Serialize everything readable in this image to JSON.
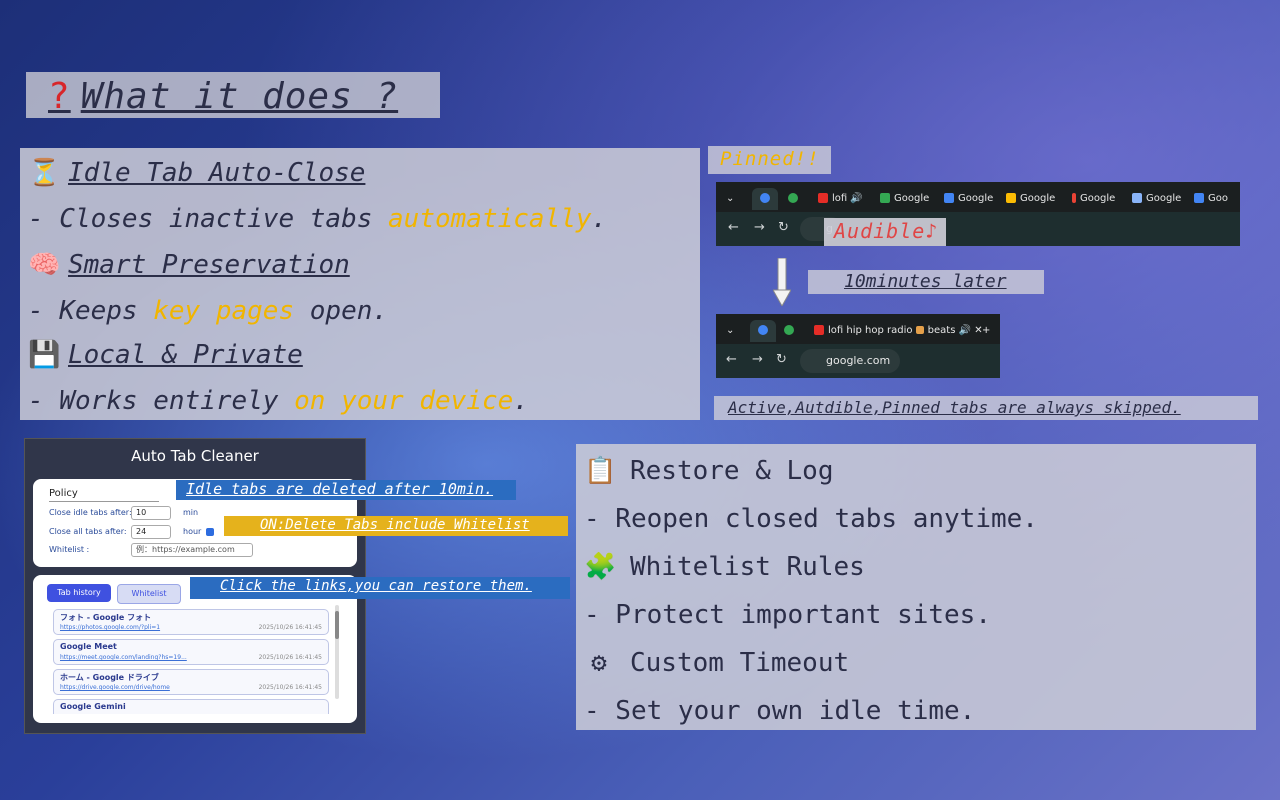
{
  "title": {
    "icon": "?",
    "text": "What it does ?"
  },
  "features": [
    {
      "icon": "⏳",
      "heading": "Idle Tab Auto-Close"
    },
    {
      "prefix": "- Closes inactive tabs ",
      "highlight": "automatically",
      "suffix": "."
    },
    {
      "icon": "🧠",
      "heading": "Smart Preservation"
    },
    {
      "prefix": "- Keeps ",
      "highlight": "key pages",
      "suffix": " open."
    },
    {
      "icon": "💾",
      "heading": "Local & Private"
    },
    {
      "prefix": "- Works entirely ",
      "highlight": "on your device",
      "suffix": "."
    }
  ],
  "demo": {
    "pinned_label": "Pinned!!",
    "audible_label": "Audible♪",
    "later_label": "10minutes later",
    "skipped_label": "Active,Autdible,Pinned tabs are always skipped.",
    "browser1_tabs": [
      "lofi",
      "Google",
      "Google",
      "Google",
      "Google",
      "Google",
      "Goo"
    ],
    "browser1_omnibox": "g",
    "browser2_tab": "lofi hip hop radio",
    "browser2_tab2": "beats",
    "browser2_omnibox": "google.com"
  },
  "popup": {
    "title": "Auto Tab Cleaner",
    "policy_label": "Policy",
    "close_idle_label": "Close idle tabs after:",
    "close_idle_value": "10",
    "close_idle_unit": "min",
    "close_all_label": "Close all tabs after:",
    "close_all_value": "24",
    "close_all_unit": "hour",
    "whitelist_label": "Whitelist :",
    "whitelist_placeholder": "例：https://example.com",
    "tab_history": "Tab history",
    "tab_whitelist": "Whitelist",
    "history": [
      {
        "title": "フォト - Google フォト",
        "url": "https://photos.google.com/?pli=1",
        "date": "2025/10/26 16:41:45"
      },
      {
        "title": "Google Meet",
        "url": "https://meet.google.com/landing?hs=19...",
        "date": "2025/10/26 16:41:45"
      },
      {
        "title": "ホーム - Google ドライブ",
        "url": "https://drive.google.com/drive/home",
        "date": "2025/10/26 16:41:45"
      },
      {
        "title": "Google Gemini",
        "url": "",
        "date": ""
      }
    ]
  },
  "callouts": {
    "idle": "Idle tabs are deleted after 10min.",
    "on_delete": "ON:Delete Tabs include Whitelist",
    "restore": "Click the links,you can restore them."
  },
  "features2": [
    {
      "icon": "📋",
      "text": "Restore & Log"
    },
    {
      "text": "- Reopen closed tabs anytime."
    },
    {
      "icon": "🧩",
      "text": "Whitelist Rules"
    },
    {
      "text": "- Protect important sites."
    },
    {
      "icon": "⚙",
      "text": "Custom Timeout"
    },
    {
      "text": "- Set your own idle time."
    }
  ],
  "colors": {
    "highlight": "#f1b500",
    "callout_blue": "#2b6cc0",
    "callout_yellow": "#e5b21c",
    "audible": "#e04545"
  }
}
